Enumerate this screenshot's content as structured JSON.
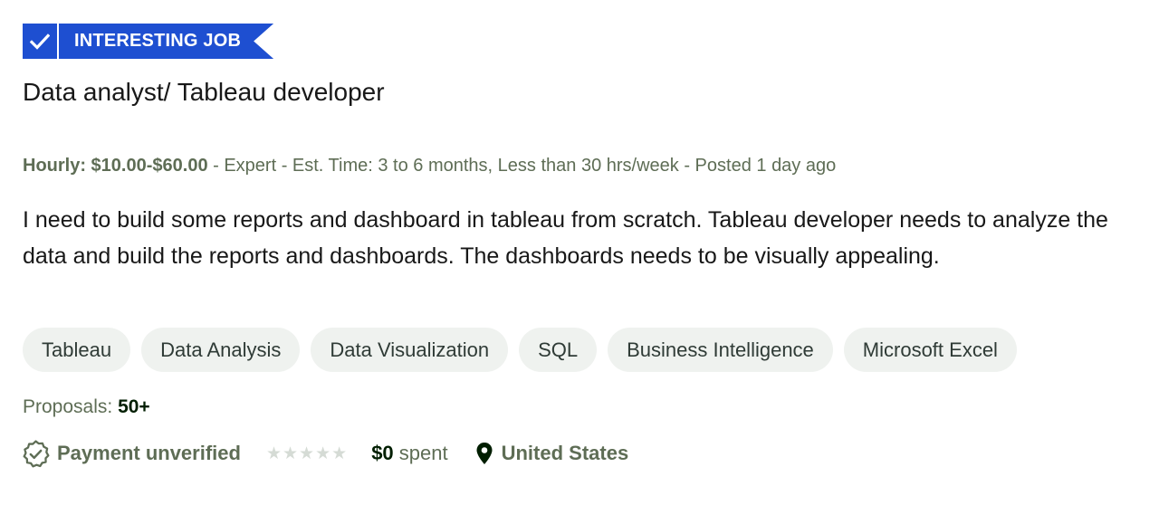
{
  "badge": {
    "label": "INTERESTING JOB",
    "icon": "checkmark-icon",
    "color": "#1e4fd1"
  },
  "job": {
    "title": "Data analyst/ Tableau developer",
    "rate": "Hourly: $10.00-$60.00",
    "meta_rest": " - Expert - Est. Time: 3 to 6 months, Less than 30 hrs/week - Posted 1 day ago",
    "description": "I need to build some reports and dashboard in tableau from scratch. Tableau developer needs to analyze the data and build the reports and dashboards. The dashboards needs to be visually appealing."
  },
  "skills": [
    {
      "label": "Tableau"
    },
    {
      "label": "Data Analysis"
    },
    {
      "label": "Data Visualization"
    },
    {
      "label": "SQL"
    },
    {
      "label": "Business Intelligence"
    },
    {
      "label": "Microsoft Excel"
    }
  ],
  "proposals": {
    "label": "Proposals: ",
    "value": "50+"
  },
  "client": {
    "payment_status": "Payment unverified",
    "payment_icon": "verified-badge-icon",
    "rating_stars": 0,
    "rating_max": 5,
    "spent_amount": "$0",
    "spent_label": " spent",
    "location_icon": "map-pin-icon",
    "location": "United States"
  }
}
